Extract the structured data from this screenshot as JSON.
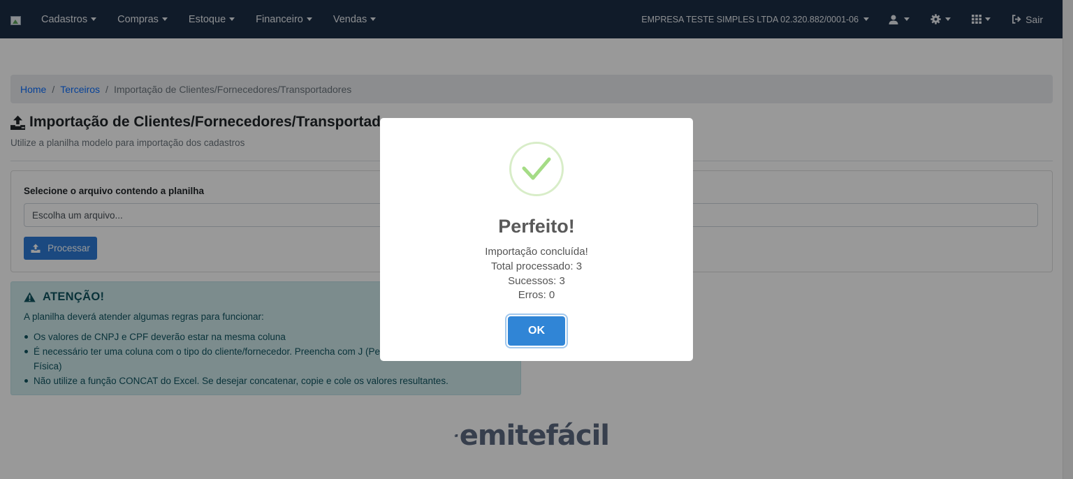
{
  "navbar": {
    "menus": [
      "Cadastros",
      "Compras",
      "Estoque",
      "Financeiro",
      "Vendas"
    ],
    "company": "EMPRESA TESTE SIMPLES LTDA 02.320.882/0001-06",
    "icons": [
      "user-icon",
      "gear-icon",
      "apps-grid-icon"
    ],
    "logout": "Sair"
  },
  "breadcrumb": {
    "home": "Home",
    "section": "Terceiros",
    "current": "Importação de Clientes/Fornecedores/Transportadores",
    "separator": "/"
  },
  "page": {
    "title": "Importação de Clientes/Fornecedores/Transportadores",
    "subtitle": "Utilize a planilha modelo para importação dos cadastros"
  },
  "upload": {
    "label": "Selecione o arquivo contendo a planilha",
    "placeholder": "Escolha um arquivo...",
    "button": "Processar"
  },
  "alert": {
    "title": "ATENÇÃO!",
    "intro": "A planilha deverá atender algumas regras para funcionar:",
    "rules": [
      "Os valores de CNPJ e CPF deverão estar na mesma coluna",
      "É necessário ter uma coluna com o tipo do cliente/fornecedor. Preencha com J (Pessoa Jurídica) ou F (Pessoa Física)",
      "Não utilize a função CONCAT do Excel. Se desejar concatenar, copie e cole os valores resultantes."
    ]
  },
  "logo": {
    "text": "emitefácil"
  },
  "modal": {
    "icon": "success-check-icon",
    "title": "Perfeito!",
    "lines": [
      "Importação concluída!",
      "Total processado: 3",
      "Sucessos: 3",
      "Erros: 0"
    ],
    "ok": "OK"
  },
  "colors": {
    "navbar": "#1c2e45",
    "primary": "#2d7bd6",
    "confirm": "#3085d6",
    "success": "#a5dc86",
    "alert_bg": "#cfe9ec"
  }
}
